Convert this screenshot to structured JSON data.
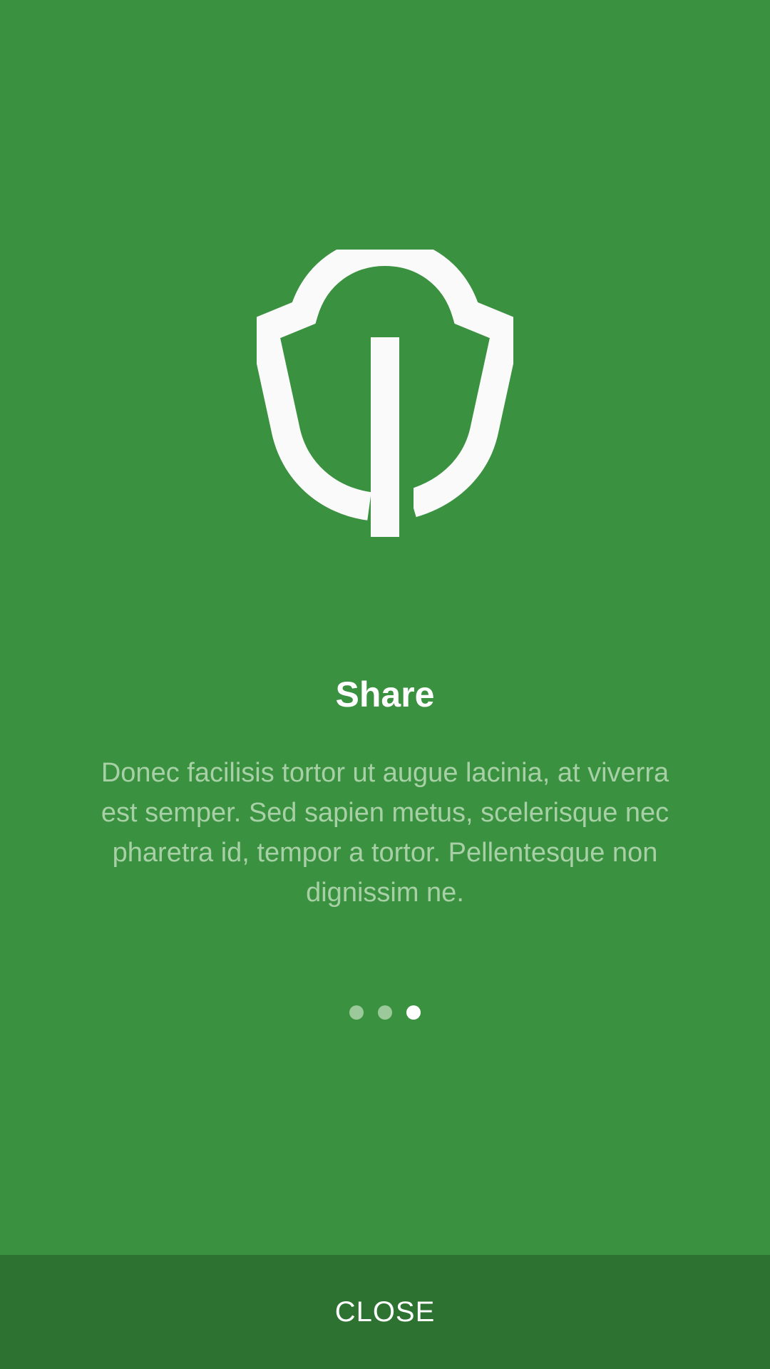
{
  "onboarding": {
    "title": "Share",
    "description": "Donec facilisis tortor ut augue lacinia, at viverra est semper. Sed sapien metus, scelerisque nec pharetra id, tempor a tortor. Pellentesque non dignissim ne.",
    "page_indicator": {
      "total": 3,
      "current": 3
    },
    "close_label": "CLOSE",
    "icon": "shield-leaf-icon"
  },
  "colors": {
    "background": "#3A913F",
    "footer": "#2D7231",
    "title": "#FFFFFF",
    "description": "#A8D0A6",
    "dot_inactive": "#9CC99A",
    "dot_active": "#FFFFFF"
  }
}
